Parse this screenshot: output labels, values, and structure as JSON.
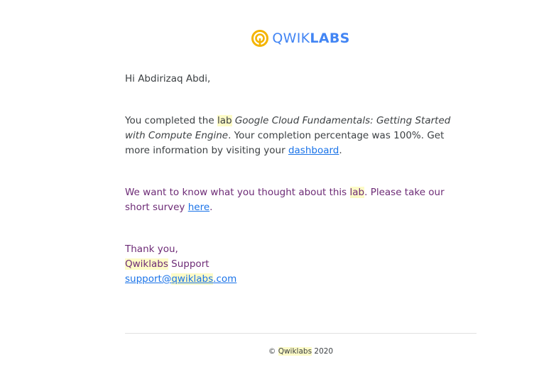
{
  "brand": {
    "name_thin": "QWIK",
    "name_bold": "LABS",
    "accent_color": "#4285f4",
    "mark_color": "#f4b400"
  },
  "email": {
    "greeting": "Hi Abdirizaq Abdi,",
    "completion": {
      "prefix": "You completed the ",
      "lab_word": "lab",
      "lab_title": "Google Cloud Fundamentals: Getting Started with Compute Engine",
      "middle": ". Your completion percentage was 100%. Get more information by visiting your ",
      "dashboard_link": "dashboard",
      "suffix": "."
    },
    "survey": {
      "prefix": "We want to know what you thought about this ",
      "lab_word": "lab",
      "middle": ". Please take our short survey ",
      "here_link": "here",
      "suffix": "."
    },
    "signoff": {
      "thanks": "Thank you,",
      "sender_highlight": "Qwiklabs",
      "sender_rest": " Support",
      "email_prefix": "support@",
      "email_highlight": "qwiklabs",
      "email_suffix": ".com"
    }
  },
  "footer": {
    "copyright": "©",
    "company": "Qwiklabs",
    "year": "2020"
  }
}
